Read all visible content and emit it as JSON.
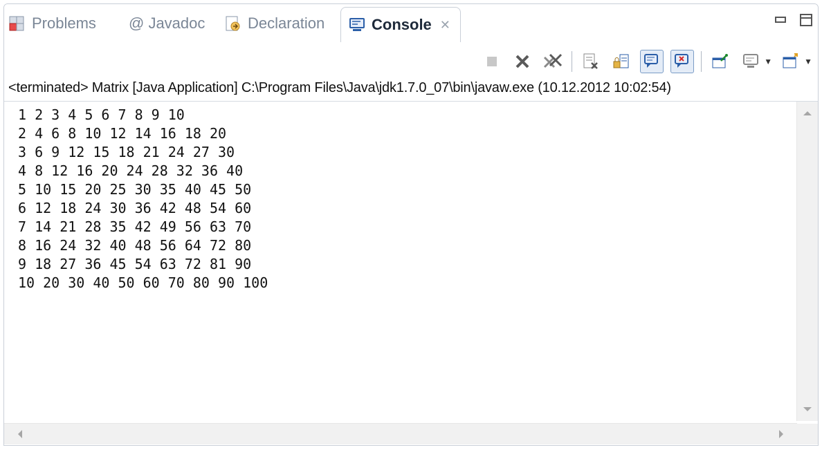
{
  "tabs": [
    {
      "label": "Problems",
      "icon": "problems-icon",
      "active": false
    },
    {
      "label": "@ Javadoc",
      "icon": "javadoc-icon",
      "active": false
    },
    {
      "label": "Declaration",
      "icon": "declaration-icon",
      "active": false
    },
    {
      "label": "Console",
      "icon": "console-icon",
      "active": true,
      "close": "✕"
    }
  ],
  "toolbar": {
    "icons": [
      "terminate-icon",
      "remove-launch-icon",
      "remove-all-terminated-icon",
      "clear-console-icon",
      "scroll-lock-icon",
      "show-console-on-stdout-icon",
      "show-console-on-stderr-icon",
      "pin-console-icon",
      "display-selected-console-icon",
      "open-console-icon"
    ]
  },
  "status": "<terminated> Matrix [Java Application] C:\\Program Files\\Java\\jdk1.7.0_07\\bin\\javaw.exe (10.12.2012 10:02:54)",
  "console_lines": [
    "1 2 3 4 5 6 7 8 9 10",
    "2 4 6 8 10 12 14 16 18 20",
    "3 6 9 12 15 18 21 24 27 30",
    "4 8 12 16 20 24 28 32 36 40",
    "5 10 15 20 25 30 35 40 45 50",
    "6 12 18 24 30 36 42 48 54 60",
    "7 14 21 28 35 42 49 56 63 70",
    "8 16 24 32 40 48 56 64 72 80",
    "9 18 27 36 45 54 63 72 81 90",
    "10 20 30 40 50 60 70 80 90 100"
  ],
  "colors": {
    "accent": "#2a5ea8",
    "text": "#111111",
    "inactive_tab": "#7a8696"
  }
}
